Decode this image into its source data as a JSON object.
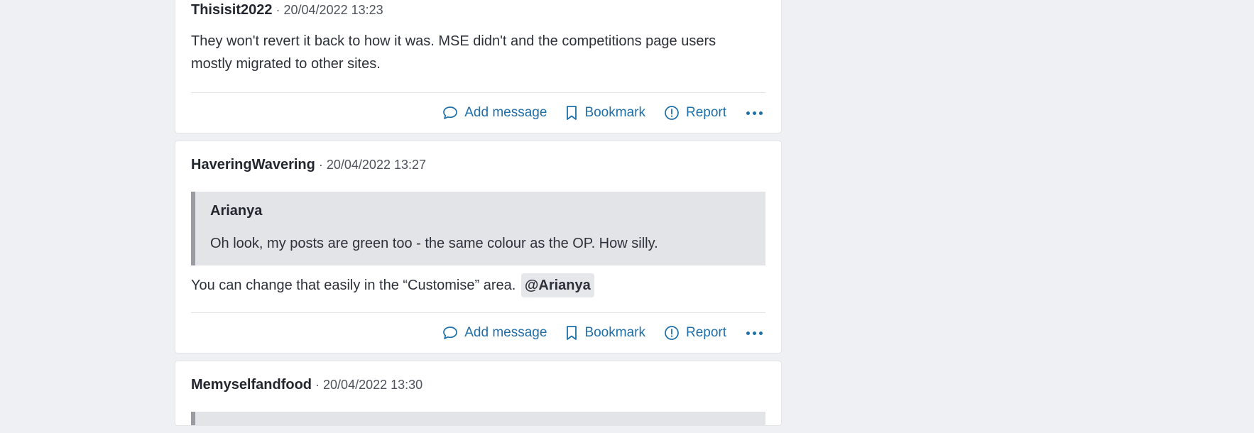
{
  "actions": {
    "add_message": "Add message",
    "bookmark": "Bookmark",
    "report": "Report"
  },
  "posts": [
    {
      "username": "Thisisit2022",
      "separator": "·",
      "timestamp": "20/04/2022 13:23",
      "body": "They won't revert it back to how it was. MSE didn't and the competitions page users mostly migrated to other sites."
    },
    {
      "username": "HaveringWavering",
      "separator": "·",
      "timestamp": "20/04/2022 13:27",
      "quote": {
        "author": "Arianya",
        "text": "Oh look, my posts are green too - the same colour as the OP. How silly."
      },
      "body": "You can change that easily in the “Customise” area.",
      "mention": "@Arianya"
    },
    {
      "username": "Memyselfandfood",
      "separator": "·",
      "timestamp": "20/04/2022 13:30"
    }
  ],
  "colors": {
    "link": "#1f6fa8",
    "page_background": "#eff0f3",
    "quote_background": "#e3e4e8"
  }
}
